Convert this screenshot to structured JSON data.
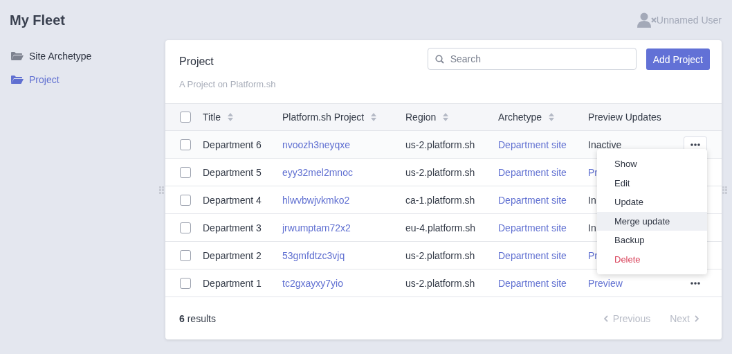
{
  "app": {
    "title": "My Fleet",
    "user": "Unnamed User"
  },
  "sidebar": {
    "items": [
      {
        "label": "Site Archetype",
        "selected": false
      },
      {
        "label": "Project",
        "selected": true
      }
    ]
  },
  "panel": {
    "title": "Project",
    "subtitle": "A Project on Platform.sh",
    "search": {
      "placeholder": "Search"
    },
    "add_button": "Add Project"
  },
  "table": {
    "columns": [
      {
        "label": "Title",
        "sortable": true
      },
      {
        "label": "Platform.sh Project",
        "sortable": true
      },
      {
        "label": "Region",
        "sortable": true
      },
      {
        "label": "Archetype",
        "sortable": true
      },
      {
        "label": "Preview Updates",
        "sortable": false
      }
    ],
    "select_all": {
      "checked": false
    },
    "rows": [
      {
        "checked": false,
        "title": "Department 6",
        "project": "nvoozh3neyqxe",
        "region": "us-2.platform.sh",
        "archetype": "Department site",
        "preview": {
          "text": "Inactive",
          "kind": "text"
        },
        "actions_button": {
          "kind": "open"
        }
      },
      {
        "checked": false,
        "title": "Department 5",
        "project": "eyy32mel2mnoc",
        "region": "us-2.platform.sh",
        "archetype": "Department site",
        "preview": {
          "text": "Pr",
          "kind": "link"
        }
      },
      {
        "checked": false,
        "title": "Department 4",
        "project": "hlwvbwjvkmko2",
        "region": "ca-1.platform.sh",
        "archetype": "Department site",
        "preview": {
          "text": "In",
          "kind": "text"
        }
      },
      {
        "checked": false,
        "title": "Department 3",
        "project": "jrwumptam72x2",
        "region": "eu-4.platform.sh",
        "archetype": "Department site",
        "preview": {
          "text": "In",
          "kind": "text"
        }
      },
      {
        "checked": false,
        "title": "Department 2",
        "project": "53gmfdtzc3vjq",
        "region": "us-2.platform.sh",
        "archetype": "Department site",
        "preview": {
          "text": "Pr",
          "kind": "link"
        }
      },
      {
        "checked": false,
        "title": "Department 1",
        "project": "tc2gxayxy7yio",
        "region": "us-2.platform.sh",
        "archetype": "Department site",
        "preview": {
          "text": "Preview",
          "kind": "link"
        },
        "actions_button": {
          "kind": "closed"
        }
      }
    ]
  },
  "row_menu": {
    "items": [
      {
        "label": "Show",
        "kind": "normal",
        "selected": false
      },
      {
        "label": "Edit",
        "kind": "normal",
        "selected": false
      },
      {
        "label": "Update",
        "kind": "normal",
        "selected": false
      },
      {
        "label": "Merge update",
        "kind": "normal",
        "selected": true
      },
      {
        "label": "Backup",
        "kind": "normal",
        "selected": false
      },
      {
        "label": "Delete",
        "kind": "danger",
        "selected": false
      }
    ]
  },
  "footer": {
    "results": "**6** results",
    "previous": {
      "label": "Previous",
      "disabled": true
    },
    "next": {
      "label": "Next",
      "disabled": true
    }
  }
}
